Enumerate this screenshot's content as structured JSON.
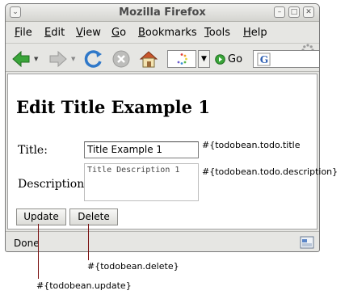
{
  "window": {
    "title": "Mozilla Firefox"
  },
  "menu": [
    {
      "label": "File",
      "key": "F",
      "rest": "ile"
    },
    {
      "label": "Edit",
      "key": "E",
      "rest": "dit"
    },
    {
      "label": "View",
      "key": "V",
      "rest": "iew"
    },
    {
      "label": "Go",
      "key": "G",
      "rest": "o"
    },
    {
      "label": "Bookmarks",
      "key": "B",
      "rest": "ookmarks"
    },
    {
      "label": "Tools",
      "key": "T",
      "rest": "ools"
    },
    {
      "label": "Help",
      "key": "H",
      "rest": "elp"
    }
  ],
  "navbar": {
    "go_label": "Go",
    "icons": [
      "back-arrow-icon",
      "forward-arrow-icon",
      "reload-icon",
      "stop-icon",
      "home-icon",
      "page-loading-icon",
      "go-icon",
      "search-engine-icon"
    ]
  },
  "page": {
    "title": "Edit Title Example 1",
    "title_label": "Title:",
    "title_value": "Title Example 1",
    "description_label": "Description:",
    "description_value": "Title Description 1",
    "update_label": "Update",
    "delete_label": "Delete"
  },
  "status": {
    "text": "Done"
  },
  "annotations": {
    "title_binding": "#{todobean.todo.title",
    "description_binding": "#{todobean.todo.description}",
    "delete_binding": "#{todobean.delete}",
    "update_binding": "#{todobean.update}"
  },
  "colors": {
    "arrow_green": "#3aa53a",
    "reload_blue": "#2f78c9",
    "connector": "#7a1010"
  }
}
